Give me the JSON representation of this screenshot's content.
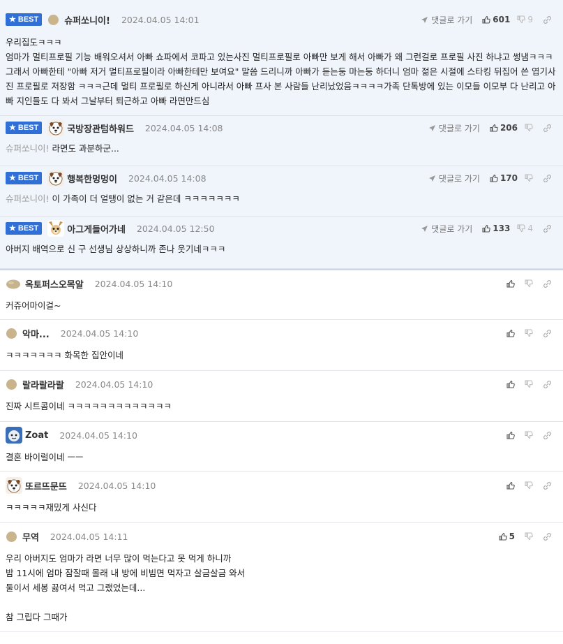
{
  "ui": {
    "best_label": "BEST",
    "reply_label": "댓글로 가기"
  },
  "comments": [
    {
      "best": true,
      "avatar": "dot",
      "nick": "슈퍼쏘니이!",
      "date": "2024.04.05 14:01",
      "up": "601",
      "down": "9",
      "quote": "",
      "text": "우리집도ㅋㅋㅋ\n엄마가 멀티프로필 기능 배워오셔서 아빠 쇼파에서 코파고 있는사진 멀티프로필로 아빠만 보게 해서 아빠가 왜 그런걸로 프로필 사진 하냐고 썽냄ㅋㅋㅋ\n그래서 아빠한테 \"아빠 저거 멀티프로필이라 아빠한테만 보여요\" 말씀 드리니까 아빠가 듣는둥 마는둥 하더니 엄마 젊은 시절에 스타킹 뒤집어 쓴 엽기사진 프로필로 저장함 ㅋㅋㅋ근데 멀티 프로필로 하신게 아니라서 아빠 프사 본 사람들 난리났었음ㅋㅋㅋㅋ가족 단톡방에 있는 이모들 이모부 다 난리고 아빠 지인들도 다 봐서 그날부터 퇴근하고 아빠 라면만드심"
    },
    {
      "best": true,
      "avatar": "dog",
      "nick": "국방장관텀하워드",
      "date": "2024.04.05 14:08",
      "up": "206",
      "down": "",
      "quote": "슈퍼쏘니이!",
      "text": "라면도 과분하군..."
    },
    {
      "best": true,
      "avatar": "dog",
      "nick": "행복한멍멍이",
      "date": "2024.04.05 14:08",
      "up": "170",
      "down": "",
      "quote": "슈퍼쏘니이!",
      "text": "이 가족이 더 얼탱이 없는 거 같은데 ㅋㅋㅋㅋㅋㅋㅋ"
    },
    {
      "best": true,
      "avatar": "chihuahua",
      "nick": "아그게들어가네",
      "date": "2024.04.05 12:50",
      "up": "133",
      "down": "4",
      "quote": "",
      "text": "아버지 배역으로 신 구 선생님 상상하니까 존나 웃기네ㅋㅋㅋ"
    },
    {
      "best": false,
      "avatar": "rock",
      "nick": "옥토퍼스오목알",
      "date": "2024.04.05 14:10",
      "up": "",
      "down": "",
      "quote": "",
      "text": "커쥬어마이걸~"
    },
    {
      "best": false,
      "avatar": "dot",
      "nick": "악마...",
      "date": "2024.04.05 14:10",
      "up": "",
      "down": "",
      "quote": "",
      "text": "ㅋㅋㅋㅋㅋㅋㅋ 화목한 집안이네"
    },
    {
      "best": false,
      "avatar": "dot",
      "nick": "랄라랄라랄",
      "date": "2024.04.05 14:10",
      "up": "",
      "down": "",
      "quote": "",
      "text": "진짜 시트콤이네 ㅋㅋㅋㅋㅋㅋㅋㅋㅋㅋㅋㅋㅋ"
    },
    {
      "best": false,
      "avatar": "blue",
      "nick": "Zoat",
      "date": "2024.04.05 14:10",
      "up": "",
      "down": "",
      "quote": "",
      "text": "결혼 바이럴이네 ㅡㅡ"
    },
    {
      "best": false,
      "avatar": "dog",
      "nick": "또르뜨문뜨",
      "date": "2024.04.05 14:10",
      "up": "",
      "down": "",
      "quote": "",
      "text": "ㅋㅋㅋㅋㅋ재밌게 사신다"
    },
    {
      "best": false,
      "avatar": "dot",
      "nick": "무역",
      "date": "2024.04.05 14:11",
      "up": "5",
      "down": "",
      "quote": "",
      "text": "우리 아버지도 엄마가 라면 너무 많이 먹는다고 못 먹게 하니까\n밤 11시에 엄마 잠잘때 몰래 내 방에 비빔면 먹자고 살금살금 와서\n둘이서 세봉 끓여서 먹고 그랬었는데...\n\n참 그립다 그때가"
    }
  ]
}
